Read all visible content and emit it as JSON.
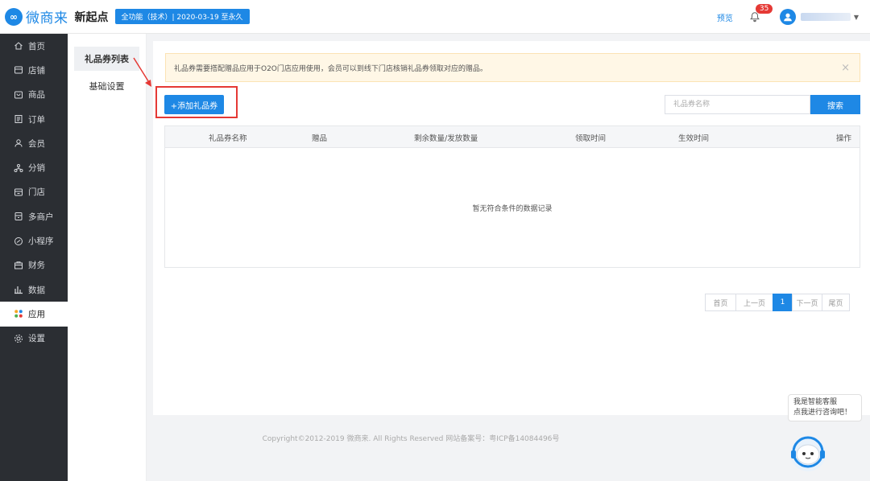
{
  "header": {
    "logo_mark": "∞",
    "logo_text": "微商来",
    "shop_name": "新起点",
    "plan_badge": "全功能（技术）| 2020-03-19 至永久",
    "preview": "预览",
    "notification_count": "35"
  },
  "sidebar": {
    "items": [
      {
        "label": "首页",
        "icon": "home-icon"
      },
      {
        "label": "店铺",
        "icon": "store-icon"
      },
      {
        "label": "商品",
        "icon": "goods-icon"
      },
      {
        "label": "订单",
        "icon": "order-icon"
      },
      {
        "label": "会员",
        "icon": "member-icon"
      },
      {
        "label": "分销",
        "icon": "distribution-icon"
      },
      {
        "label": "门店",
        "icon": "shop-icon"
      },
      {
        "label": "多商户",
        "icon": "merchant-icon"
      },
      {
        "label": "小程序",
        "icon": "miniprogram-icon"
      },
      {
        "label": "财务",
        "icon": "finance-icon"
      },
      {
        "label": "数据",
        "icon": "data-icon"
      },
      {
        "label": "应用",
        "icon": "apps-icon"
      },
      {
        "label": "设置",
        "icon": "settings-icon"
      }
    ],
    "active_index": 11
  },
  "subnav": {
    "items": [
      "礼品券列表",
      "基础设置"
    ],
    "active_index": 0
  },
  "notice": {
    "text": "礼品券需要搭配赠品应用于O2O门店应用使用，会员可以到线下门店核销礼品券领取对应的赠品。",
    "close": "×"
  },
  "toolbar": {
    "add_label": "+添加礼品券",
    "search_placeholder": "礼品券名称",
    "search_label": "搜索"
  },
  "table": {
    "columns": [
      "礼品券名称",
      "赠品",
      "剩余数量/发放数量",
      "领取时间",
      "生效时间",
      "操作"
    ],
    "rows": [],
    "empty_text": "暂无符合条件的数据记录"
  },
  "pagination": {
    "first": "首页",
    "prev": "上一页",
    "current": "1",
    "next": "下一页",
    "last": "尾页"
  },
  "footer": {
    "copyright": "Copyright©2012-2019 微商来. All Rights Reserved 网站备案号：粤ICP备14084496号"
  },
  "assistant": {
    "line1": "我是智能客服",
    "line2": "点我进行咨询吧！"
  },
  "colors": {
    "accent": "#1e88e5",
    "sidebar_bg": "#2b2e33",
    "highlight": "#e53935",
    "notice_bg": "#fff7e6"
  }
}
